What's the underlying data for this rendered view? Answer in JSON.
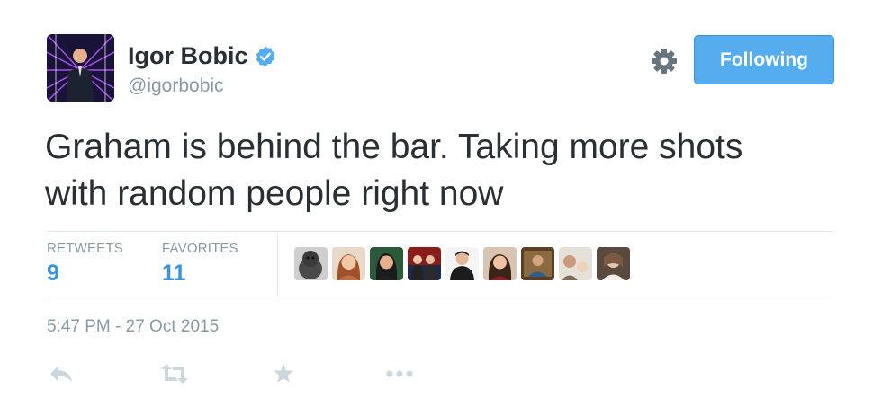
{
  "tweet": {
    "author": {
      "name": "Igor Bobic",
      "handle": "@igorbobic",
      "verified": true
    },
    "follow_button_label": "Following",
    "text_lines": [
      "Graham is behind the bar. Taking more shots",
      "with random people right now"
    ],
    "stats": {
      "retweets_label": "RETWEETS",
      "retweets_value": "9",
      "favorites_label": "FAVORITES",
      "favorites_value": "11"
    },
    "favoriters": [
      {
        "icon": "dog-avatar"
      },
      {
        "icon": "woman-avatar"
      },
      {
        "icon": "woman-avatar"
      },
      {
        "icon": "group-avatar"
      },
      {
        "icon": "man-avatar"
      },
      {
        "icon": "woman-avatar"
      },
      {
        "icon": "person-avatar"
      },
      {
        "icon": "person-avatar"
      },
      {
        "icon": "person-avatar"
      }
    ],
    "timestamp": "5:47 PM - 27 Oct 2015",
    "actions": [
      "reply-icon",
      "retweet-icon",
      "favorite-icon",
      "more-icon"
    ]
  },
  "colors": {
    "accent": "#55acee",
    "link": "#3b94d9",
    "muted": "#8899a6",
    "text": "#292f33",
    "border": "#e1e8ed"
  }
}
